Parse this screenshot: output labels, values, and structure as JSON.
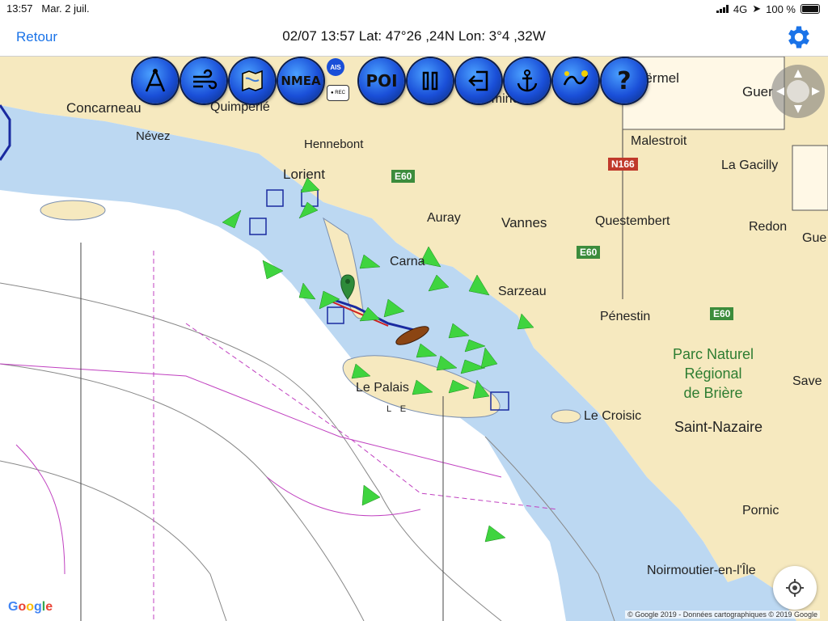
{
  "status_bar": {
    "time": "13:57",
    "date": "Mar. 2 juil.",
    "network": "4G",
    "battery": "100 %"
  },
  "nav": {
    "back_label": "Retour",
    "title": "02/07 13:57  Lat: 47°26 ,24N Lon: 3°4 ,32W"
  },
  "toolbar": [
    {
      "name": "compass-tool-button",
      "label": ""
    },
    {
      "name": "wind-button",
      "label": ""
    },
    {
      "name": "chart-map-button",
      "label": ""
    },
    {
      "name": "nmea-button",
      "label": "NMEA"
    },
    {
      "name": "poi-button",
      "label": "POI"
    },
    {
      "name": "pause-button",
      "label": ""
    },
    {
      "name": "exit-button",
      "label": ""
    },
    {
      "name": "anchor-button",
      "label": ""
    },
    {
      "name": "tide-button",
      "label": ""
    },
    {
      "name": "help-button",
      "label": "?"
    }
  ],
  "ais_badge": "AIS",
  "rec_badge": "● REC",
  "places": {
    "concarneau": "Concarneau",
    "quimperle": "Quimperlé",
    "nevez": "Névez",
    "hennebont": "Hennebont",
    "lorient": "Lorient",
    "locmine": "Locminé",
    "ploermel": "oërmel",
    "guer": "Guer",
    "malestroit": "Malestroit",
    "la_gacilly": "La Gacilly",
    "auray": "Auray",
    "vannes": "Vannes",
    "questembert": "Questembert",
    "redon": "Redon",
    "gue": "Gue",
    "carnac": "Carna",
    "sarzeau": "Sarzeau",
    "penestin": "Pénestin",
    "le_palais": "Le Palais",
    "le_croisic": "Le Croisic",
    "saint_nazaire": "Saint-Nazaire",
    "save": "Save",
    "pornic": "Pornic",
    "noirmoutier": "Noirmoutier-en-l'Île",
    "park_line1": "Parc Naturel",
    "park_line2": "Régional",
    "park_line3": "de Brière",
    "le_palais_belle": "L E"
  },
  "roads": {
    "e60_a": "E60",
    "e60_b": "E60",
    "e60_c": "E60",
    "n166": "N166"
  },
  "attribution": {
    "google": "Google",
    "copyright": "© Google 2019 - Données cartographiques © 2019 Google"
  },
  "colors": {
    "accent": "#1a73e8",
    "land": "#f6e9bf",
    "shallow": "#bcd8f2",
    "sea": "#ffffff",
    "ais_target": "#3fd43f",
    "road_green": "#3c8c3c",
    "road_red": "#c0392b"
  }
}
